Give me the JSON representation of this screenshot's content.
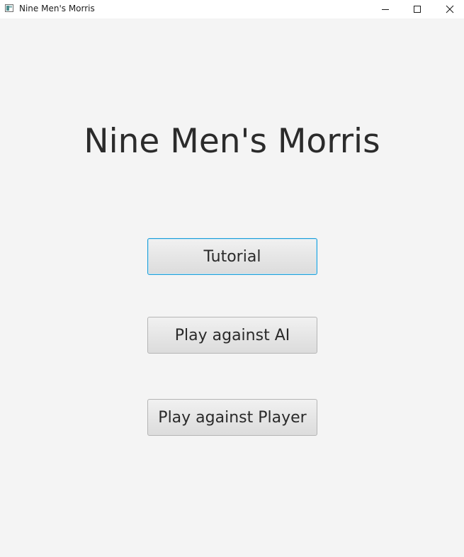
{
  "window": {
    "title": "Nine Men's Morris",
    "controls": {
      "minimize_icon": "minimize-icon",
      "maximize_icon": "maximize-icon",
      "close_icon": "close-icon"
    }
  },
  "main": {
    "title": "Nine Men's Morris",
    "buttons": {
      "tutorial": "Tutorial",
      "play_ai": "Play against AI",
      "play_player": "Play against Player"
    }
  },
  "colors": {
    "background": "#f4f4f4",
    "focus_border": "#1e9fd8",
    "button_border": "#b5b5b5",
    "text": "#2b2b2b"
  }
}
